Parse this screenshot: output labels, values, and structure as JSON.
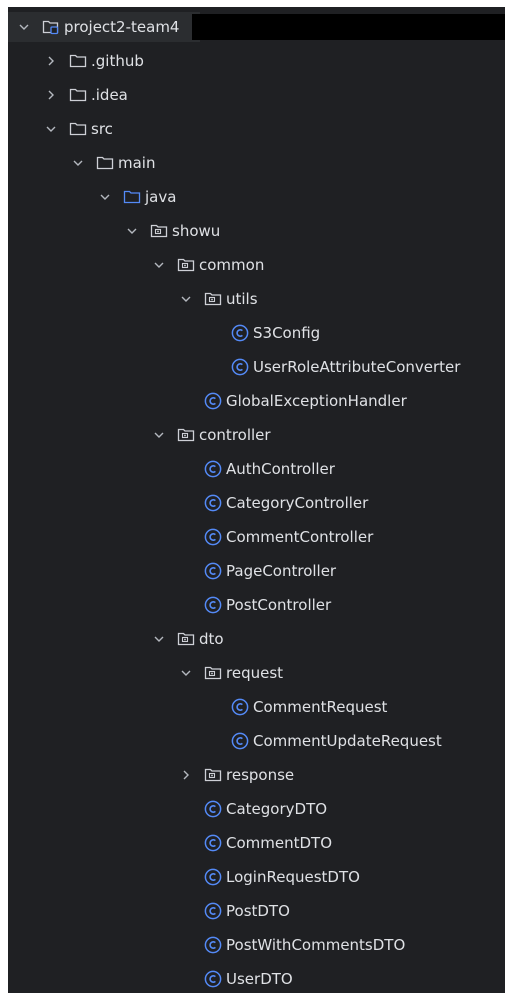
{
  "tree": {
    "root_label": "project2-team4",
    "github_label": ".github",
    "idea_label": ".idea",
    "src_label": "src",
    "main_label": "main",
    "java_label": "java",
    "showu_label": "showu",
    "common_label": "common",
    "utils_label": "utils",
    "s3config_label": "S3Config",
    "userrole_label": "UserRoleAttributeConverter",
    "globalex_label": "GlobalExceptionHandler",
    "controller_label": "controller",
    "authctrl_label": "AuthController",
    "categoryctrl_label": "CategoryController",
    "commentctrl_label": "CommentController",
    "pagectrl_label": "PageController",
    "postctrl_label": "PostController",
    "dto_label": "dto",
    "request_label": "request",
    "commentreq_label": "CommentRequest",
    "commentupdreq_label": "CommentUpdateRequest",
    "response_label": "response",
    "categorydto_label": "CategoryDTO",
    "commentdto_label": "CommentDTO",
    "loginreqdto_label": "LoginRequestDTO",
    "postdto_label": "PostDTO",
    "postwithcommentsdto_label": "PostWithCommentsDTO",
    "userdto_label": "UserDTO"
  },
  "colors": {
    "background": "#1f2023",
    "text": "#dfe1e5",
    "chevron": "#b4b8bf",
    "folder_icon": "#ced0d6",
    "source_folder_icon": "#548af7",
    "class_icon": "#548af7"
  },
  "icons": {
    "expanded": "chevron-down-icon",
    "collapsed": "chevron-right-icon",
    "module": "module-folder-icon",
    "folder": "folder-icon",
    "source_folder": "source-folder-icon",
    "package": "package-icon",
    "class": "class-icon"
  }
}
